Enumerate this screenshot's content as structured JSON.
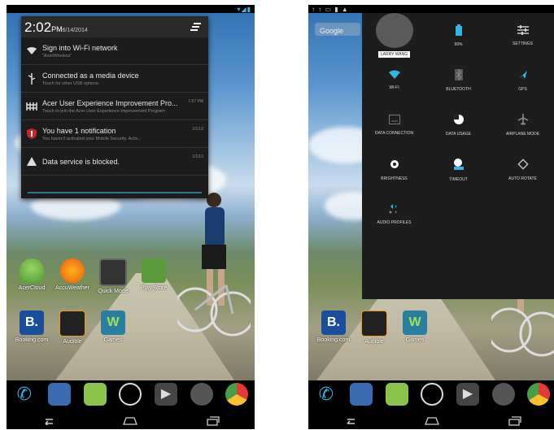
{
  "left": {
    "notifications_time": "2:02",
    "notifications_ampm": "PM",
    "notifications_date": "6/14/2014",
    "notifications": [
      {
        "icon": "wifi-icon",
        "title": "Sign into Wi-Fi network",
        "subtitle": "\"AcerWireless\"",
        "time": ""
      },
      {
        "icon": "usb-icon",
        "title": "Connected as a media device",
        "subtitle": "Touch for other USB options.",
        "time": ""
      },
      {
        "icon": "program-icon",
        "title": "Acer User Experience Improvement Pro...",
        "subtitle": "Touch to join the Acer User Experience Improvement Program",
        "time": "1:57 PM"
      },
      {
        "icon": "security-icon",
        "title": "You have 1 notification",
        "subtitle": "You haven't activated your Mobile Security. Activ...",
        "time": "1/1/13"
      },
      {
        "icon": "warning-icon",
        "title": "Data service is blocked.",
        "subtitle": "",
        "time": "1/1/13"
      }
    ],
    "apps_row1": [
      "AcerCloud",
      "AccuWeather",
      "Quick Mode",
      "Play Store"
    ],
    "apps_row2": [
      "Booking.com",
      "Audible",
      "Games"
    ]
  },
  "right": {
    "search_hint": "Google",
    "user_name": "LARRY WANG",
    "tiles": [
      {
        "icon": "battery-icon",
        "label": "99%",
        "color": "#33b5e5"
      },
      {
        "icon": "settings-icon",
        "label": "SETTINGS",
        "color": "#d0d0d0"
      },
      {
        "icon": "wifi-icon",
        "label": "WI-FI",
        "color": "#33b5e5"
      },
      {
        "icon": "bluetooth-icon",
        "label": "BLUETOOTH",
        "color": "#777777"
      },
      {
        "icon": "gps-icon",
        "label": "GPS",
        "color": "#33b5e5"
      },
      {
        "icon": "data-connection-icon",
        "label": "DATA CONNECTION",
        "color": "#777777"
      },
      {
        "icon": "data-usage-icon",
        "label": "DATA USAGE",
        "color": "#ffffff"
      },
      {
        "icon": "airplane-icon",
        "label": "AIRPLANE MODE",
        "color": "#888888"
      },
      {
        "icon": "brightness-icon",
        "label": "BRIGHTNESS",
        "color": "#ffffff"
      },
      {
        "icon": "timeout-icon",
        "label": "TIMEOUT",
        "color": "#33b5e5"
      },
      {
        "icon": "auto-rotate-icon",
        "label": "AUTO ROTATE",
        "color": "#cccccc"
      },
      {
        "icon": "audio-profiles-icon",
        "label": "AUDIO PROFILES",
        "color": "#33b5e5"
      }
    ],
    "apps_row2": [
      "Booking.com",
      "Audible",
      "Games"
    ]
  },
  "colors": {
    "accent": "#33b5e5",
    "panel": "#1d1d1d"
  }
}
